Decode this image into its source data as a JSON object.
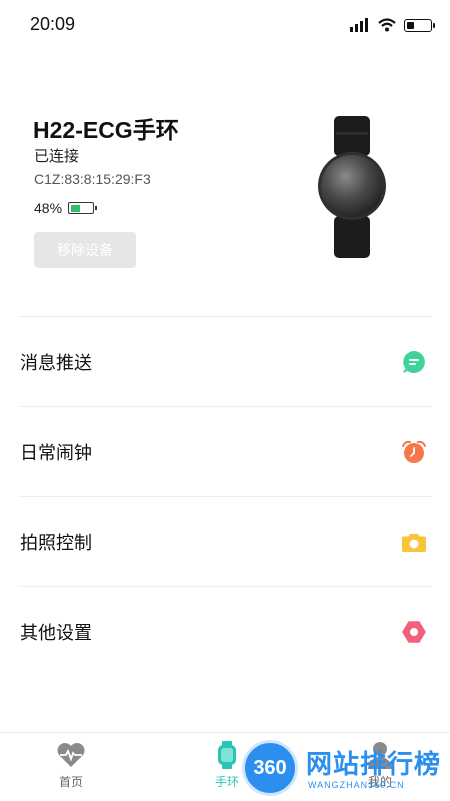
{
  "status_bar": {
    "time": "20:09",
    "battery_level_percent": 35
  },
  "device": {
    "name": "H22-ECG手环",
    "connection_status": "已连接",
    "mac": "C1Z:83:8:15:29:F3",
    "battery_text": "48%",
    "battery_level_percent": 48,
    "remove_label": "移除设备"
  },
  "menu": {
    "items": [
      {
        "label": "消息推送",
        "icon": "message-icon",
        "color": "#3dd39a"
      },
      {
        "label": "日常闹钟",
        "icon": "alarm-clock-icon",
        "color": "#f5784a"
      },
      {
        "label": "拍照控制",
        "icon": "camera-icon",
        "color": "#f7c43a"
      },
      {
        "label": "其他设置",
        "icon": "settings-hexagon-icon",
        "color": "#f2607a"
      }
    ]
  },
  "tabs": [
    {
      "label": "首页",
      "icon": "heart-pulse-icon"
    },
    {
      "label": "手环",
      "icon": "band-icon",
      "active": true
    },
    {
      "label": "我的",
      "icon": "user-icon"
    }
  ],
  "watermark": {
    "logo_text": "360",
    "title": "网站排行榜",
    "subtitle": "WANGZHAN360.CN"
  },
  "colors": {
    "accent": "#2bc4b4",
    "battery_green": "#2fbf71"
  }
}
